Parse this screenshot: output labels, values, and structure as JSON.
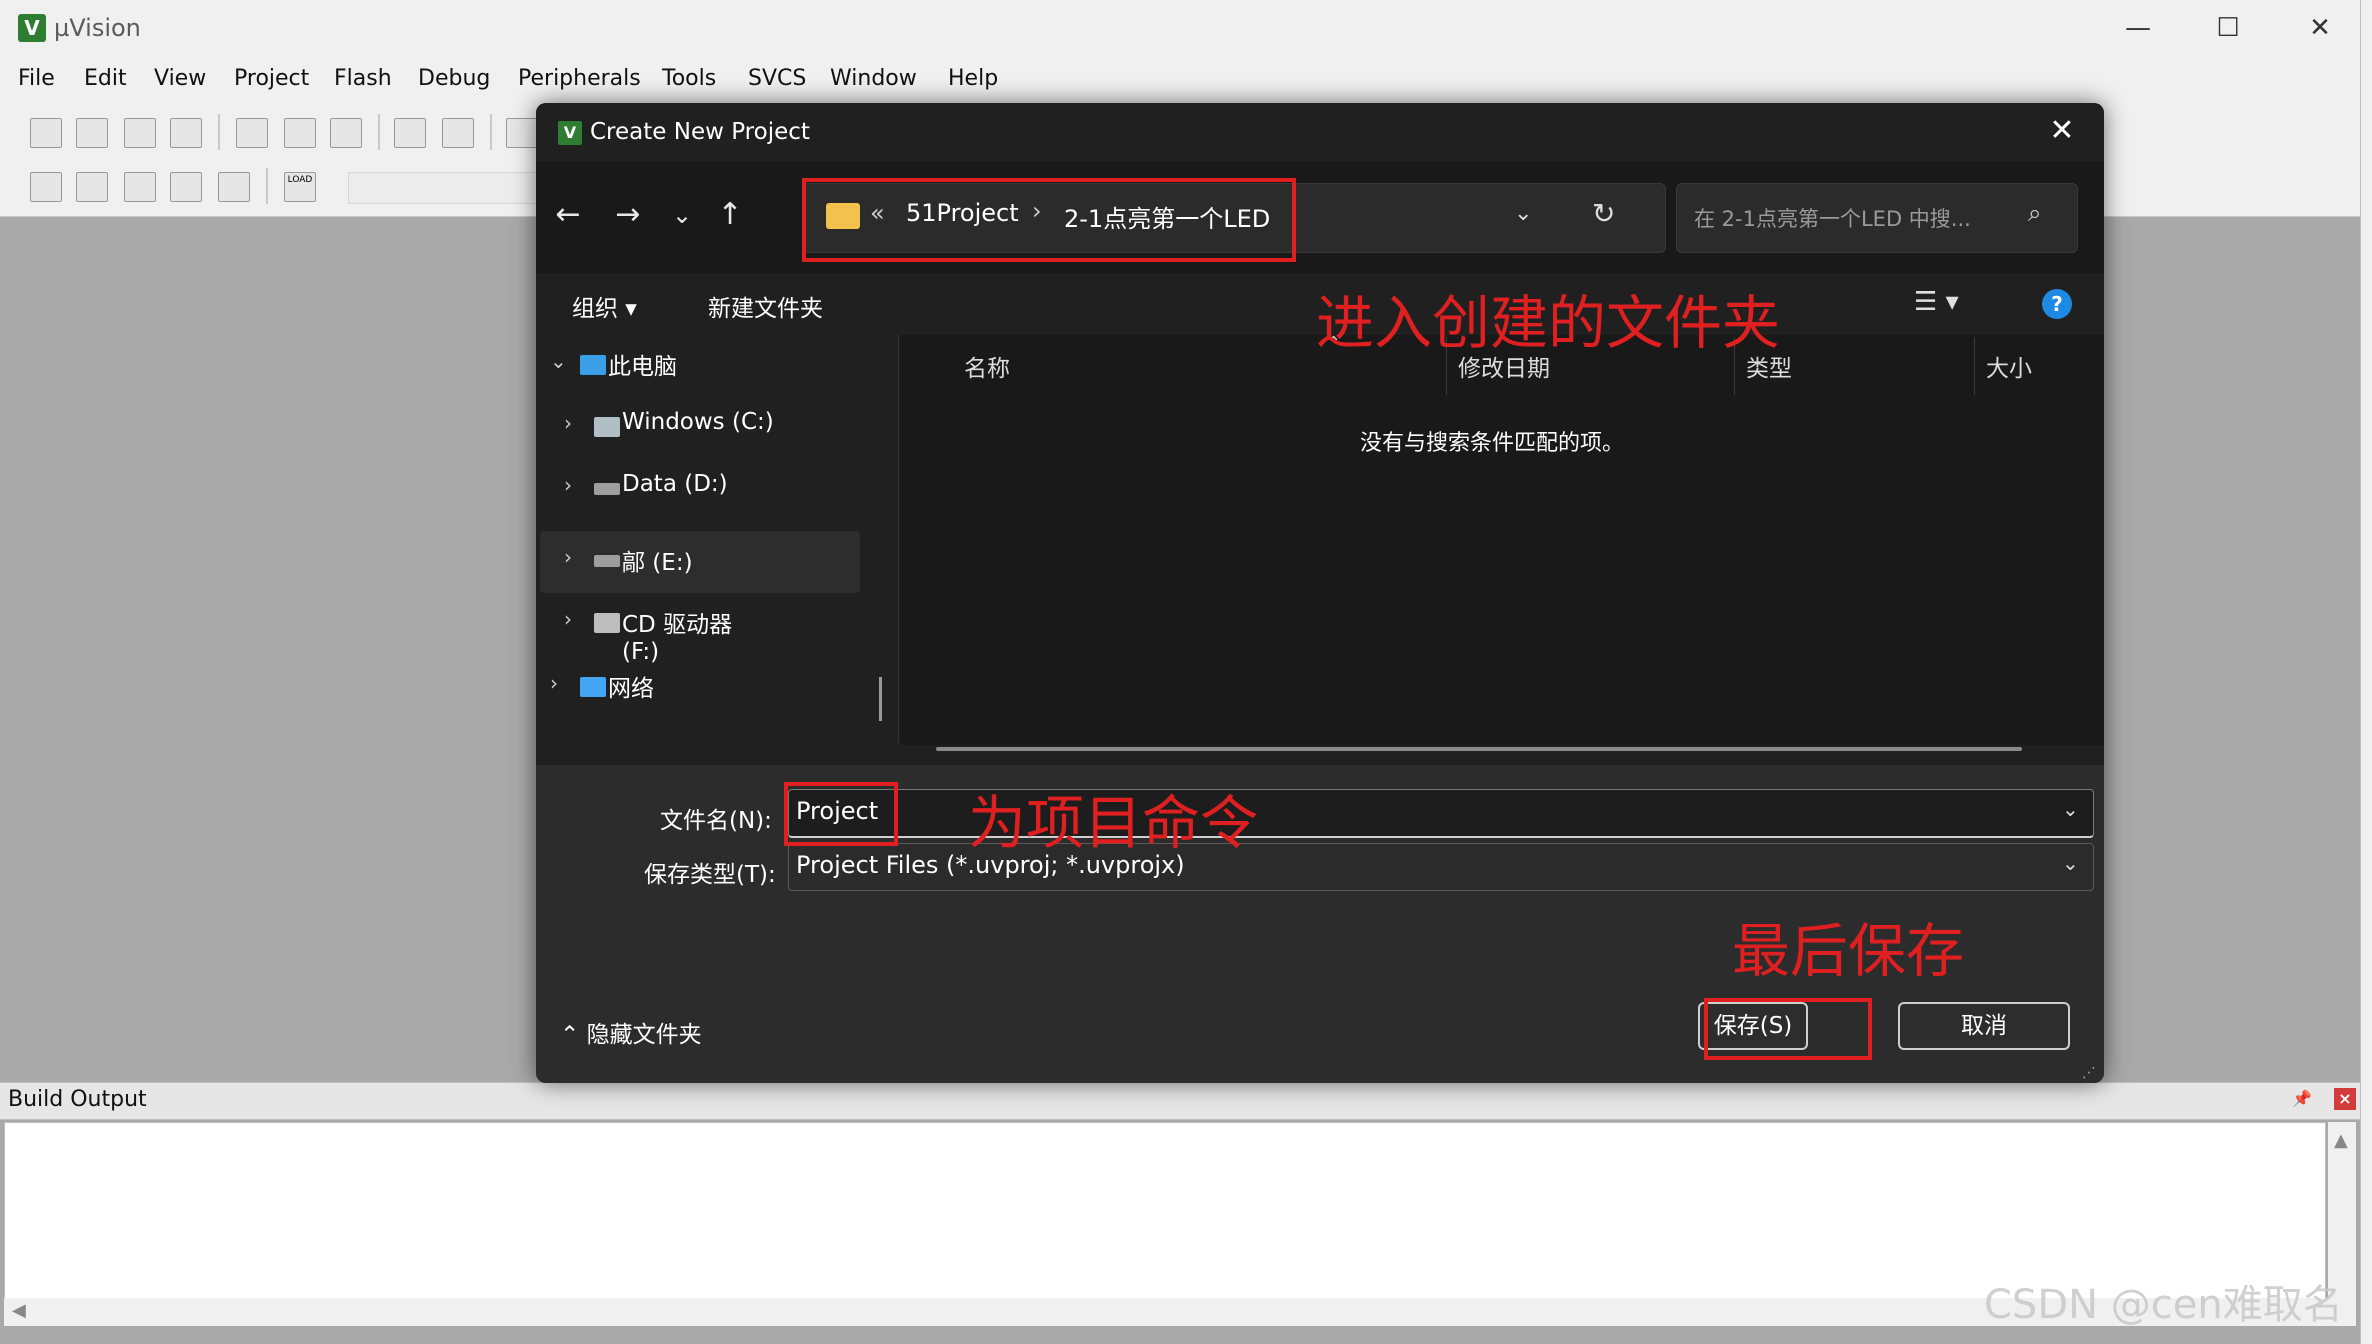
{
  "app": {
    "logo_text": "V",
    "title": "µVision",
    "minimize": "—",
    "maximize": "☐",
    "close": "✕"
  },
  "menu": [
    "File",
    "Edit",
    "View",
    "Project",
    "Flash",
    "Debug",
    "Peripherals",
    "Tools",
    "SVCS",
    "Window",
    "Help"
  ],
  "toolbar": {
    "load_label": "LOAD"
  },
  "build_output": {
    "title": "Build Output",
    "pin": "📌",
    "close": "×",
    "scroll_up": "▲",
    "scroll_left": "◀"
  },
  "dialog": {
    "logo_text": "V",
    "title": "Create New Project",
    "close": "✕",
    "nav": {
      "back": "←",
      "forward": "→",
      "recent": "⌄",
      "up": "↑"
    },
    "breadcrumb": {
      "prefix": "«",
      "folder1": "51Project",
      "separator": "›",
      "folder2": "2-1点亮第一个LED",
      "dropdown": "⌄",
      "refresh": "↻"
    },
    "search_placeholder": "在 2-1点亮第一个LED 中搜...",
    "search_icon": "⌕",
    "commands": {
      "organize": "组织 ▾",
      "new_folder": "新建文件夹",
      "view": "☰ ▾",
      "help": "?"
    },
    "tree": [
      {
        "arrow": "⌄",
        "label": "此电脑",
        "icon": "monitor-icon"
      },
      {
        "arrow": "›",
        "label": "Windows (C:)",
        "icon": "windows-drive-icon"
      },
      {
        "arrow": "›",
        "label": "Data (D:)",
        "icon": "drive-icon"
      },
      {
        "arrow": "›",
        "label": "鄗 (E:)",
        "icon": "drive-icon"
      },
      {
        "arrow": "›",
        "label": "CD 驱动器 (F:)",
        "icon": "cd-drive-icon"
      },
      {
        "arrow": "›",
        "label": "网络",
        "icon": "network-icon"
      }
    ],
    "columns": {
      "name": "名称",
      "modified": "修改日期",
      "type": "类型",
      "size": "大小",
      "sort_caret": "⌃"
    },
    "empty_message": "没有与搜索条件匹配的项。",
    "file_name_label": "文件名(N):",
    "file_name_value": "Project",
    "file_type_label": "保存类型(T):",
    "file_type_value": "Project Files (*.uvproj; *.uvprojx)",
    "combo_arrow": "⌄",
    "hide_folders": "⌃ 隐藏文件夹",
    "save_button": "保存(S)",
    "cancel_button": "取消",
    "grip": "⋰"
  },
  "annotations": {
    "enter_folder": "进入创建的文件夹",
    "name_project": "为项目命令",
    "save_last": "最后保存",
    "color": "#e02020"
  },
  "watermark": "CSDN @cen难取名"
}
